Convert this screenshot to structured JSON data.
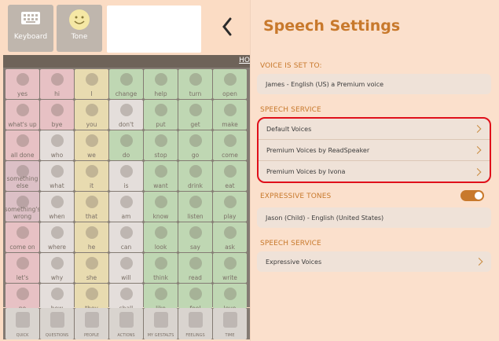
{
  "topbar": {
    "keyboard_label": "Keyboard",
    "tone_label": "Tone",
    "home_label": "HO"
  },
  "grid": {
    "rows": [
      [
        "yes",
        "hi",
        "I",
        "change",
        "help",
        "turn",
        "open"
      ],
      [
        "what's up",
        "bye",
        "you",
        "don't",
        "put",
        "get",
        "make"
      ],
      [
        "all done",
        "who",
        "we",
        "do",
        "stop",
        "go",
        "come"
      ],
      [
        "something else",
        "what",
        "it",
        "is",
        "want",
        "drink",
        "eat"
      ],
      [
        "something's wrong",
        "when",
        "that",
        "am",
        "know",
        "listen",
        "play"
      ],
      [
        "come on",
        "where",
        "he",
        "can",
        "look",
        "say",
        "ask"
      ],
      [
        "let's",
        "why",
        "she",
        "will",
        "think",
        "read",
        "write"
      ],
      [
        "no",
        "how",
        "they",
        "shall",
        "like",
        "feel",
        "love"
      ]
    ],
    "colors": [
      [
        "pink",
        "pink",
        "yellow",
        "green",
        "green",
        "green",
        "green"
      ],
      [
        "pink",
        "pink",
        "yellow",
        "white",
        "green",
        "green",
        "green"
      ],
      [
        "pink",
        "white",
        "yellow",
        "green",
        "green",
        "green",
        "green"
      ],
      [
        "pink2",
        "white",
        "yellow",
        "white",
        "green",
        "green",
        "green"
      ],
      [
        "pink2",
        "white",
        "yellow",
        "white",
        "green",
        "green",
        "green"
      ],
      [
        "pink",
        "white",
        "yellow",
        "white",
        "green",
        "green",
        "green"
      ],
      [
        "pink",
        "white",
        "yellow",
        "white",
        "green",
        "green",
        "green"
      ],
      [
        "pink",
        "white",
        "yellow",
        "white",
        "green",
        "green",
        "green"
      ]
    ]
  },
  "bottom_tabs": [
    "QUICK",
    "QUESTIONS",
    "PEOPLE",
    "ACTIONS",
    "MY GESTALTS",
    "FEELINGS",
    "TIME"
  ],
  "settings": {
    "title": "Speech Settings",
    "voice_section": "VOICE IS SET TO:",
    "voice_value": "James - English (US) a Premium voice",
    "service_section": "SPEECH SERVICE",
    "services": [
      "Default Voices",
      "Premium Voices by ReadSpeaker",
      "Premium Voices by Ivona"
    ],
    "expressive_section": "EXPRESSIVE TONES",
    "expressive_on": true,
    "expressive_voice": "Jason (Child) - English (United States)",
    "service_section_2": "SPEECH SERVICE",
    "expressive_voices": "Expressive Voices"
  },
  "colors": {
    "accent": "#c8792c",
    "highlight": "#e0101a",
    "panel_bg": "#fbe0cc"
  }
}
